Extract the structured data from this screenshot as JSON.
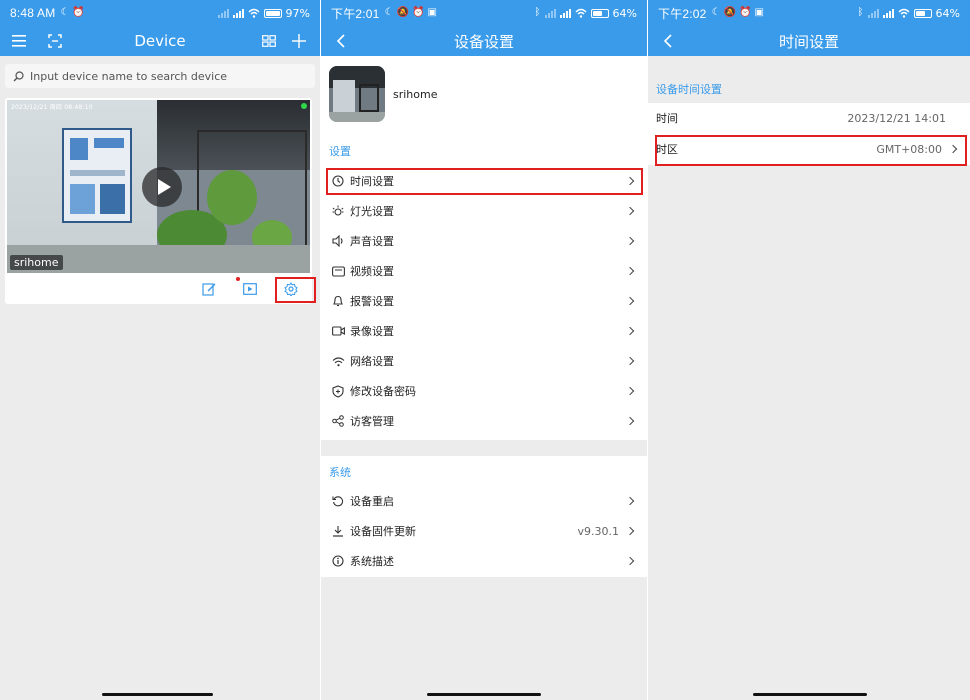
{
  "panel1": {
    "status": {
      "time": "8:48 AM",
      "battery": "97"
    },
    "nav": {
      "title": "Device"
    },
    "search": {
      "placeholder": "Input device name to search device"
    },
    "device": {
      "name": "srihome",
      "timestamp": "2023/12/21 周四 08:48:10"
    }
  },
  "panel2": {
    "status": {
      "time": "下午2:01",
      "battery": "64"
    },
    "nav": {
      "title": "设备设置"
    },
    "device_name": "srihome",
    "section_settings": "设置",
    "settings": [
      {
        "label": "时间设置",
        "icon": "clock-icon"
      },
      {
        "label": "灯光设置",
        "icon": "light-icon"
      },
      {
        "label": "声音设置",
        "icon": "speaker-icon"
      },
      {
        "label": "视频设置",
        "icon": "video-icon"
      },
      {
        "label": "报警设置",
        "icon": "bell-icon"
      },
      {
        "label": "录像设置",
        "icon": "camera-icon"
      },
      {
        "label": "网络设置",
        "icon": "wifi-icon"
      },
      {
        "label": "修改设备密码",
        "icon": "shield-icon"
      },
      {
        "label": "访客管理",
        "icon": "share-icon"
      }
    ],
    "section_system": "系统",
    "system": [
      {
        "label": "设备重启",
        "icon": "restart-icon",
        "value": ""
      },
      {
        "label": "设备固件更新",
        "icon": "download-icon",
        "value": "v9.30.1"
      },
      {
        "label": "系统描述",
        "icon": "info-icon",
        "value": ""
      }
    ]
  },
  "panel3": {
    "status": {
      "time": "下午2:02",
      "battery": "64"
    },
    "nav": {
      "title": "时间设置"
    },
    "section": "设备时间设置",
    "time_label": "时间",
    "time_value": "2023/12/21 14:01",
    "zone_label": "时区",
    "zone_value": "GMT+08:00"
  },
  "colors": {
    "accent": "#3a9bea",
    "highlight": "#e02020",
    "background": "#ececec"
  }
}
